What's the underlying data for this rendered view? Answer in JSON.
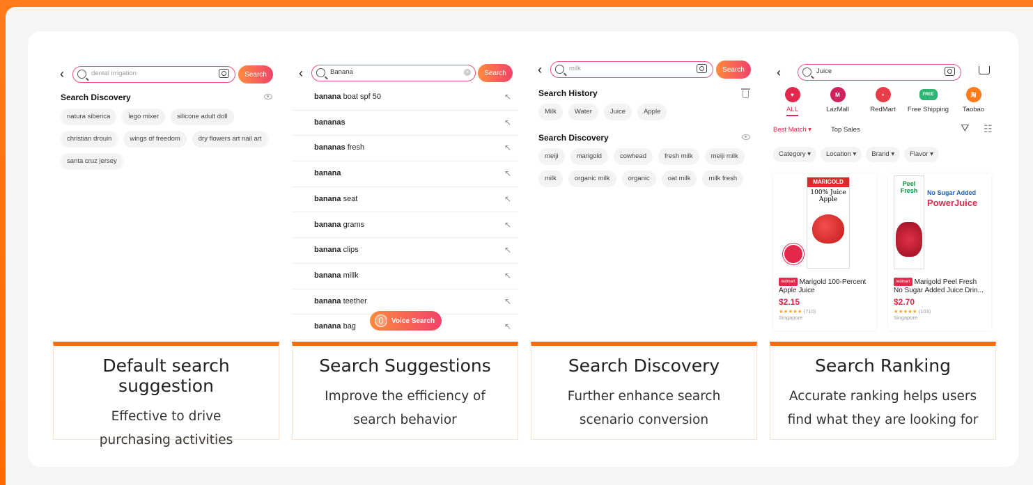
{
  "panels": [
    {
      "caption_title": "Default search suggestion",
      "caption_sub": "Effective to drive purchasing activities",
      "search_text": "dental irrigation",
      "search_button": "Search",
      "section_title": "Search Discovery",
      "chips": [
        "natura siberica",
        "lego mixer",
        "silicone adult doll",
        "christian drouin",
        "wings of freedom",
        "dry flowers art nail art",
        "santa cruz jersey"
      ]
    },
    {
      "caption_title": "Search Suggestions",
      "caption_sub": "Improve the efficiency of search behavior",
      "search_text": "Banana",
      "search_button": "Search",
      "suggestions": [
        {
          "bold": "banana",
          "rest": " boat spf 50"
        },
        {
          "bold": "bananas",
          "rest": ""
        },
        {
          "bold": "bananas",
          "rest": " fresh"
        },
        {
          "bold": "banana",
          "rest": ""
        },
        {
          "bold": "banana",
          "rest": " seat"
        },
        {
          "bold": "banana",
          "rest": " grams"
        },
        {
          "bold": "banana",
          "rest": " clips"
        },
        {
          "bold": "banana",
          "rest": " millk"
        },
        {
          "bold": "banana",
          "rest": " teether"
        },
        {
          "bold": "banana",
          "rest": " bag"
        }
      ],
      "voice_label": "Voice Search"
    },
    {
      "caption_title": "Search Discovery",
      "caption_sub": "Further enhance search scenario conversion",
      "search_text": "milk",
      "search_button": "Search",
      "history_title": "Search History",
      "history": [
        "Milk",
        "Water",
        "Juice",
        "Apple"
      ],
      "discovery_title": "Search Discovery",
      "discovery": [
        "meiji",
        "marigold",
        "cowhead",
        "fresh milk",
        "meiji milk",
        "milk",
        "organic milk",
        "organic",
        "oat milk",
        "milk fresh"
      ]
    },
    {
      "caption_title": "Search Ranking",
      "caption_sub": "Accurate ranking helps users find what they are looking for",
      "search_text": "Juice",
      "categories": [
        {
          "label": "ALL",
          "color": "#e3284b",
          "icon": "heart-icon",
          "glyph": "♥"
        },
        {
          "label": "LazMall",
          "color": "#d0215f",
          "icon": "lazmall-icon",
          "glyph": "M"
        },
        {
          "label": "RedMart",
          "color": "#ea3d4a",
          "icon": "redmart-icon",
          "glyph": "•"
        },
        {
          "label": "Free Shipping",
          "color": "#2bb673",
          "icon": "truck-icon",
          "glyph": "FREE"
        },
        {
          "label": "Taobao",
          "color": "#ff7a1a",
          "icon": "taobao-icon",
          "glyph": "淘"
        }
      ],
      "sort_best": "Best Match",
      "sort_top": "Top Sales",
      "filters": [
        "Category",
        "Location",
        "Brand",
        "Flavor"
      ],
      "products": [
        {
          "brand_tag": "redmart",
          "name": "Marigold 100-Percent Apple Juice",
          "price": "$2.15",
          "reviews": "(710)",
          "location": "Singapore",
          "box_brand": "MARIGOLD",
          "box_text": "100% Juice",
          "box_sub": "Apple"
        },
        {
          "brand_tag": "redmart",
          "name": "Marigold Peel Fresh No Sugar Added Juice Drin...",
          "price": "$2.70",
          "reviews": "(103)",
          "location": "Singapore",
          "box_brand": "Peel Fresh",
          "box_text": "No Sugar Added",
          "box_sub": "PowerJuice"
        }
      ]
    }
  ]
}
